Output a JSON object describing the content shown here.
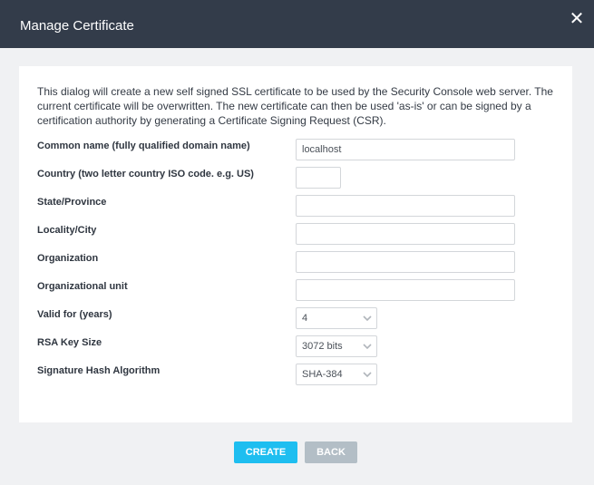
{
  "dialog": {
    "title": "Manage Certificate",
    "close_glyph": "✕"
  },
  "description": "This dialog will create a new self signed SSL certificate to be used by the Security Console web server. The current certificate will be overwritten. The new certificate can then be used 'as-is' or can be signed by a certification authority by generating a Certificate Signing Request (CSR).",
  "form": {
    "common_name": {
      "label": "Common name (fully qualified domain name)",
      "value": "localhost"
    },
    "country": {
      "label": "Country (two letter country ISO code. e.g. US)",
      "value": ""
    },
    "state": {
      "label": "State/Province",
      "value": ""
    },
    "locality": {
      "label": "Locality/City",
      "value": ""
    },
    "organization": {
      "label": "Organization",
      "value": ""
    },
    "org_unit": {
      "label": "Organizational unit",
      "value": ""
    },
    "valid_for": {
      "label": "Valid for (years)",
      "value": "4"
    },
    "rsa_key_size": {
      "label": "RSA Key Size",
      "value": "3072 bits"
    },
    "signature_hash": {
      "label": "Signature Hash Algorithm",
      "value": "SHA-384"
    }
  },
  "buttons": {
    "create": "CREATE",
    "back": "BACK"
  },
  "colors": {
    "titlebar": "#333c4a",
    "create_button": "#1ebef0",
    "back_button": "#b3bec6"
  }
}
